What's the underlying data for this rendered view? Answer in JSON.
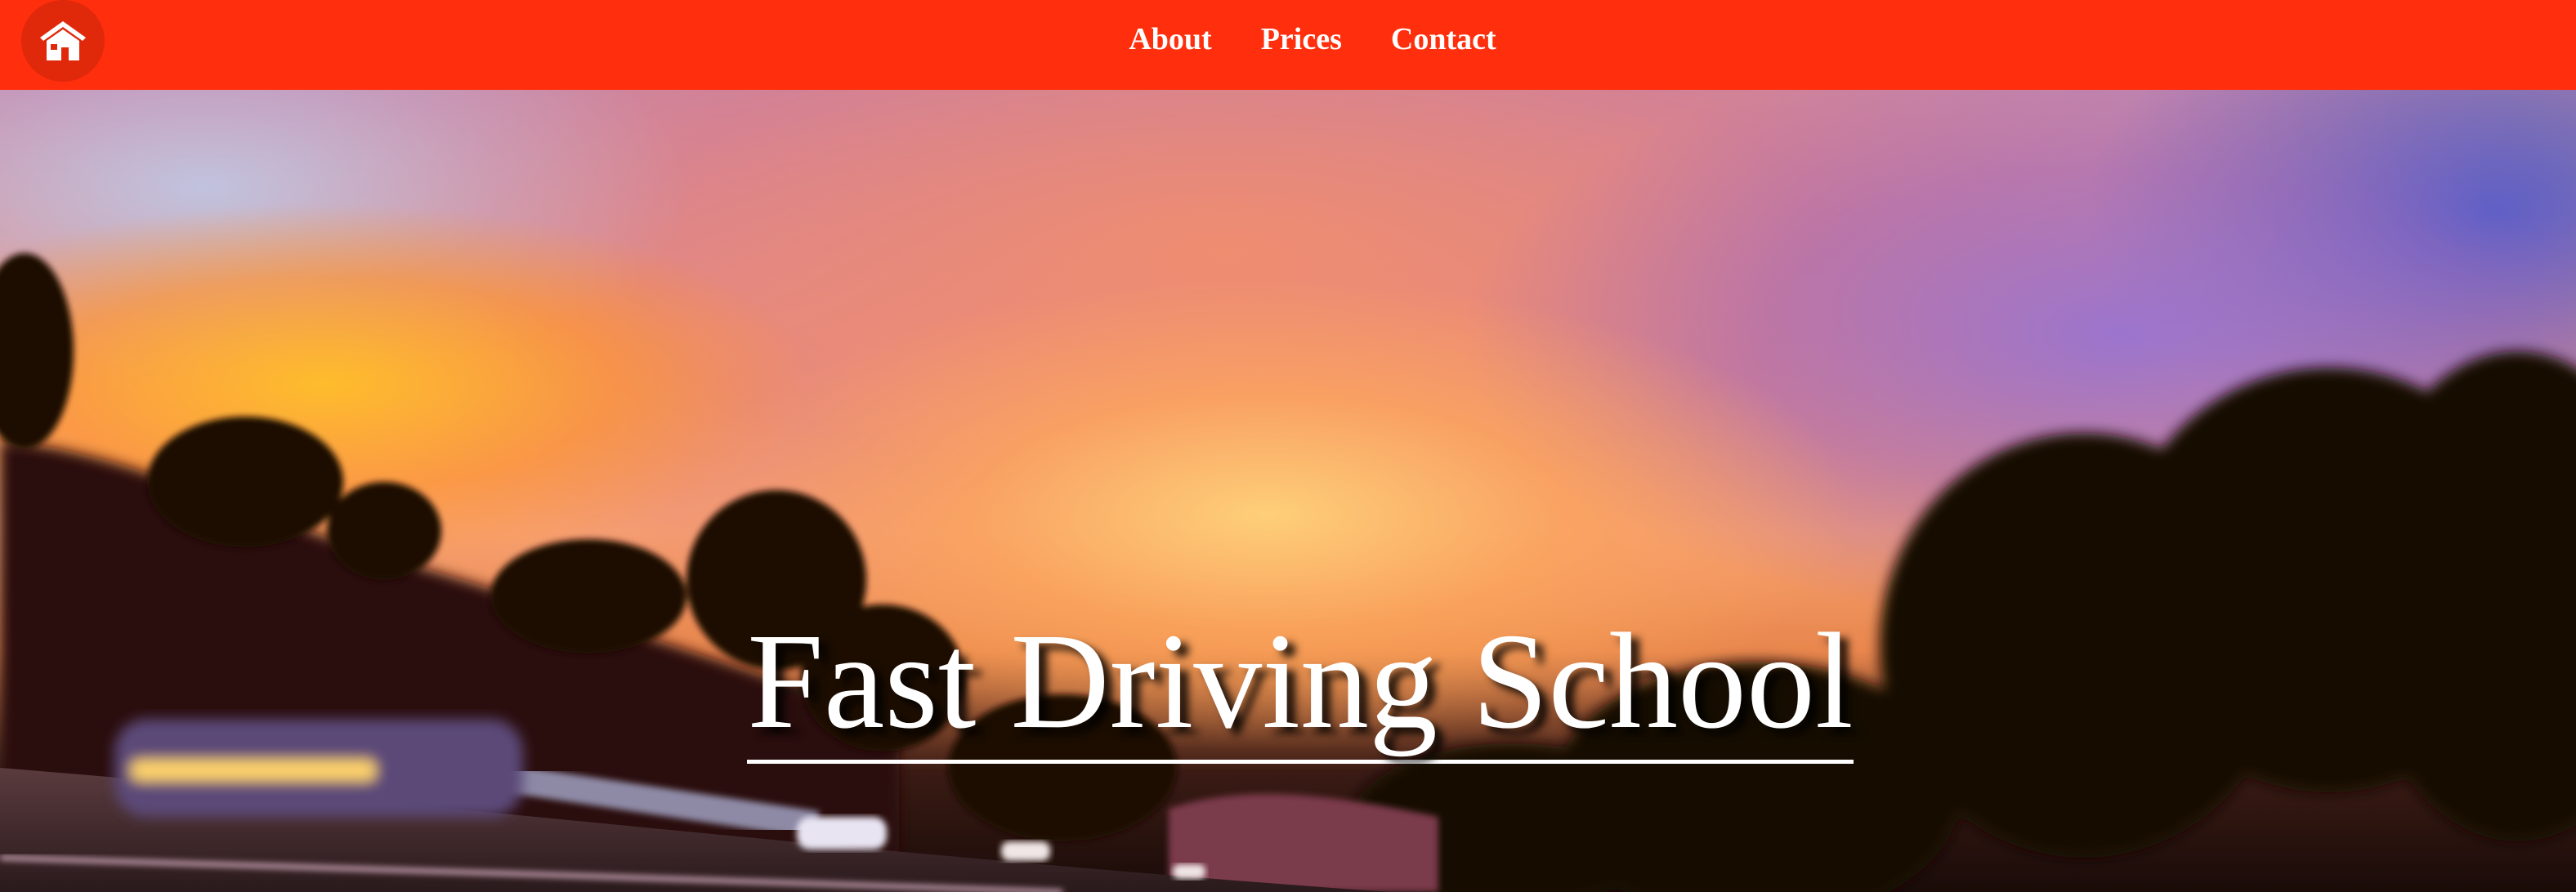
{
  "navbar": {
    "home_icon": "home-icon",
    "links": [
      {
        "label": "About"
      },
      {
        "label": "Prices"
      },
      {
        "label": "Contact"
      }
    ],
    "background_color": "#ff2f0d"
  },
  "hero": {
    "title": "Fast Driving School",
    "image": "sunset-highway-photo"
  }
}
